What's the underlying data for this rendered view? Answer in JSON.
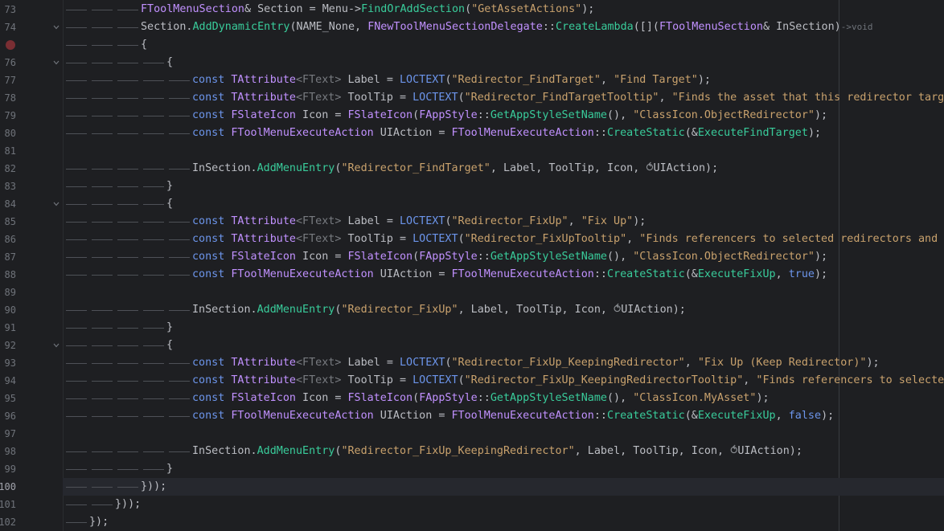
{
  "editor": {
    "lines": [
      {
        "num": "73",
        "indent": 3,
        "tokens": [
          [
            "ty",
            "FToolMenuSection"
          ],
          [
            "pl",
            "& Section = Menu->"
          ],
          [
            "fn",
            "FindOrAddSection"
          ],
          [
            "pl",
            "("
          ],
          [
            "st",
            "\"GetAssetActions\""
          ],
          [
            "pl",
            ");"
          ]
        ]
      },
      {
        "num": "74",
        "indent": 3,
        "fold": true,
        "tokens": [
          [
            "pl",
            "Section."
          ],
          [
            "fn",
            "AddDynamicEntry"
          ],
          [
            "pl",
            "(NAME_None, "
          ],
          [
            "ty",
            "FNewToolMenuSectionDelegate"
          ],
          [
            "pl",
            "::"
          ],
          [
            "fn",
            "CreateLambda"
          ],
          [
            "pl",
            "([]("
          ],
          [
            "ty",
            "FToolMenuSection"
          ],
          [
            "pl",
            "& InSection)"
          ],
          [
            "hint",
            "->void"
          ]
        ]
      },
      {
        "num": "75",
        "indent": 3,
        "breakpoint": true,
        "tokens": [
          [
            "pl",
            "{"
          ]
        ]
      },
      {
        "num": "76",
        "indent": 4,
        "fold": true,
        "tokens": [
          [
            "pl",
            "{"
          ]
        ]
      },
      {
        "num": "77",
        "indent": 5,
        "tokens": [
          [
            "kw",
            "const "
          ],
          [
            "ty",
            "TAttribute"
          ],
          [
            "gr",
            "<FText>"
          ],
          [
            "pl",
            " Label = "
          ],
          [
            "mac",
            "LOCTEXT"
          ],
          [
            "pl",
            "("
          ],
          [
            "st",
            "\"Redirector_FindTarget\""
          ],
          [
            "pl",
            ", "
          ],
          [
            "st",
            "\"Find Target\""
          ],
          [
            "pl",
            ");"
          ]
        ]
      },
      {
        "num": "78",
        "indent": 5,
        "tokens": [
          [
            "kw",
            "const "
          ],
          [
            "ty",
            "TAttribute"
          ],
          [
            "gr",
            "<FText>"
          ],
          [
            "pl",
            " ToolTip = "
          ],
          [
            "mac",
            "LOCTEXT"
          ],
          [
            "pl",
            "("
          ],
          [
            "st",
            "\"Redirector_FindTargetTooltip\""
          ],
          [
            "pl",
            ", "
          ],
          [
            "st",
            "\"Finds the asset that this redirector targe"
          ]
        ]
      },
      {
        "num": "79",
        "indent": 5,
        "tokens": [
          [
            "kw",
            "const "
          ],
          [
            "ty",
            "FSlateIcon"
          ],
          [
            "pl",
            " Icon = "
          ],
          [
            "ty",
            "FSlateIcon"
          ],
          [
            "pl",
            "("
          ],
          [
            "ty",
            "FAppStyle"
          ],
          [
            "pl",
            "::"
          ],
          [
            "fn",
            "GetAppStyleSetName"
          ],
          [
            "pl",
            "(), "
          ],
          [
            "st",
            "\"ClassIcon.ObjectRedirector\""
          ],
          [
            "pl",
            ");"
          ]
        ]
      },
      {
        "num": "80",
        "indent": 5,
        "tokens": [
          [
            "kw",
            "const "
          ],
          [
            "ty",
            "FToolMenuExecuteAction"
          ],
          [
            "pl",
            " UIAction = "
          ],
          [
            "ty",
            "FToolMenuExecuteAction"
          ],
          [
            "pl",
            "::"
          ],
          [
            "fn",
            "CreateStatic"
          ],
          [
            "pl",
            "(&"
          ],
          [
            "fn",
            "ExecuteFindTarget"
          ],
          [
            "pl",
            ");"
          ]
        ]
      },
      {
        "num": "81",
        "indent": 0,
        "tokens": []
      },
      {
        "num": "82",
        "indent": 5,
        "tokens": [
          [
            "pl",
            "InSection."
          ],
          [
            "fn",
            "AddMenuEntry"
          ],
          [
            "pl",
            "("
          ],
          [
            "st",
            "\"Redirector_FindTarget\""
          ],
          [
            "pl",
            ", Label, ToolTip, Icon, "
          ],
          [
            "cap",
            "⥀"
          ],
          [
            "pl",
            "UIAction);"
          ]
        ]
      },
      {
        "num": "83",
        "indent": 4,
        "tokens": [
          [
            "pl",
            "}"
          ]
        ]
      },
      {
        "num": "84",
        "indent": 4,
        "fold": true,
        "tokens": [
          [
            "pl",
            "{"
          ]
        ]
      },
      {
        "num": "85",
        "indent": 5,
        "tokens": [
          [
            "kw",
            "const "
          ],
          [
            "ty",
            "TAttribute"
          ],
          [
            "gr",
            "<FText>"
          ],
          [
            "pl",
            " Label = "
          ],
          [
            "mac",
            "LOCTEXT"
          ],
          [
            "pl",
            "("
          ],
          [
            "st",
            "\"Redirector_FixUp\""
          ],
          [
            "pl",
            ", "
          ],
          [
            "st",
            "\"Fix Up\""
          ],
          [
            "pl",
            ");"
          ]
        ]
      },
      {
        "num": "86",
        "indent": 5,
        "tokens": [
          [
            "kw",
            "const "
          ],
          [
            "ty",
            "TAttribute"
          ],
          [
            "gr",
            "<FText>"
          ],
          [
            "pl",
            " ToolTip = "
          ],
          [
            "mac",
            "LOCTEXT"
          ],
          [
            "pl",
            "("
          ],
          [
            "st",
            "\"Redirector_FixUpTooltip\""
          ],
          [
            "pl",
            ", "
          ],
          [
            "st",
            "\"Finds referencers to selected redirectors and r"
          ]
        ]
      },
      {
        "num": "87",
        "indent": 5,
        "tokens": [
          [
            "kw",
            "const "
          ],
          [
            "ty",
            "FSlateIcon"
          ],
          [
            "pl",
            " Icon = "
          ],
          [
            "ty",
            "FSlateIcon"
          ],
          [
            "pl",
            "("
          ],
          [
            "ty",
            "FAppStyle"
          ],
          [
            "pl",
            "::"
          ],
          [
            "fn",
            "GetAppStyleSetName"
          ],
          [
            "pl",
            "(), "
          ],
          [
            "st",
            "\"ClassIcon.ObjectRedirector\""
          ],
          [
            "pl",
            ");"
          ]
        ]
      },
      {
        "num": "88",
        "indent": 5,
        "tokens": [
          [
            "kw",
            "const "
          ],
          [
            "ty",
            "FToolMenuExecuteAction"
          ],
          [
            "pl",
            " UIAction = "
          ],
          [
            "ty",
            "FToolMenuExecuteAction"
          ],
          [
            "pl",
            "::"
          ],
          [
            "fn",
            "CreateStatic"
          ],
          [
            "pl",
            "(&"
          ],
          [
            "fn",
            "ExecuteFixUp"
          ],
          [
            "pl",
            ", "
          ],
          [
            "kw",
            "true"
          ],
          [
            "pl",
            ");"
          ]
        ]
      },
      {
        "num": "89",
        "indent": 0,
        "tokens": []
      },
      {
        "num": "90",
        "indent": 5,
        "tokens": [
          [
            "pl",
            "InSection."
          ],
          [
            "fn",
            "AddMenuEntry"
          ],
          [
            "pl",
            "("
          ],
          [
            "st",
            "\"Redirector_FixUp\""
          ],
          [
            "pl",
            ", Label, ToolTip, Icon, "
          ],
          [
            "cap",
            "⥀"
          ],
          [
            "pl",
            "UIAction);"
          ]
        ]
      },
      {
        "num": "91",
        "indent": 4,
        "tokens": [
          [
            "pl",
            "}"
          ]
        ]
      },
      {
        "num": "92",
        "indent": 4,
        "fold": true,
        "tokens": [
          [
            "pl",
            "{"
          ]
        ]
      },
      {
        "num": "93",
        "indent": 5,
        "tokens": [
          [
            "kw",
            "const "
          ],
          [
            "ty",
            "TAttribute"
          ],
          [
            "gr",
            "<FText>"
          ],
          [
            "pl",
            " Label = "
          ],
          [
            "mac",
            "LOCTEXT"
          ],
          [
            "pl",
            "("
          ],
          [
            "st",
            "\"Redirector_FixUp_KeepingRedirector\""
          ],
          [
            "pl",
            ", "
          ],
          [
            "st",
            "\"Fix Up (Keep Redirector)\""
          ],
          [
            "pl",
            ");"
          ]
        ]
      },
      {
        "num": "94",
        "indent": 5,
        "tokens": [
          [
            "kw",
            "const "
          ],
          [
            "ty",
            "TAttribute"
          ],
          [
            "gr",
            "<FText>"
          ],
          [
            "pl",
            " ToolTip = "
          ],
          [
            "mac",
            "LOCTEXT"
          ],
          [
            "pl",
            "("
          ],
          [
            "st",
            "\"Redirector_FixUp_KeepingRedirectorTooltip\""
          ],
          [
            "pl",
            ", "
          ],
          [
            "st",
            "\"Finds referencers to selected"
          ]
        ]
      },
      {
        "num": "95",
        "indent": 5,
        "tokens": [
          [
            "kw",
            "const "
          ],
          [
            "ty",
            "FSlateIcon"
          ],
          [
            "pl",
            " Icon = "
          ],
          [
            "ty",
            "FSlateIcon"
          ],
          [
            "pl",
            "("
          ],
          [
            "ty",
            "FAppStyle"
          ],
          [
            "pl",
            "::"
          ],
          [
            "fn",
            "GetAppStyleSetName"
          ],
          [
            "pl",
            "(), "
          ],
          [
            "st",
            "\"ClassIcon.MyAsset\""
          ],
          [
            "pl",
            ");"
          ]
        ]
      },
      {
        "num": "96",
        "indent": 5,
        "tokens": [
          [
            "kw",
            "const "
          ],
          [
            "ty",
            "FToolMenuExecuteAction"
          ],
          [
            "pl",
            " UIAction = "
          ],
          [
            "ty",
            "FToolMenuExecuteAction"
          ],
          [
            "pl",
            "::"
          ],
          [
            "fn",
            "CreateStatic"
          ],
          [
            "pl",
            "(&"
          ],
          [
            "fn",
            "ExecuteFixUp"
          ],
          [
            "pl",
            ", "
          ],
          [
            "kw",
            "false"
          ],
          [
            "pl",
            ");"
          ]
        ]
      },
      {
        "num": "97",
        "indent": 0,
        "tokens": []
      },
      {
        "num": "98",
        "indent": 5,
        "tokens": [
          [
            "pl",
            "InSection."
          ],
          [
            "fn",
            "AddMenuEntry"
          ],
          [
            "pl",
            "("
          ],
          [
            "st",
            "\"Redirector_FixUp_KeepingRedirector\""
          ],
          [
            "pl",
            ", Label, ToolTip, Icon, "
          ],
          [
            "cap",
            "⥀"
          ],
          [
            "pl",
            "UIAction);"
          ]
        ]
      },
      {
        "num": "99",
        "indent": 4,
        "tokens": [
          [
            "pl",
            "}"
          ]
        ]
      },
      {
        "num": "100",
        "indent": 3,
        "current": true,
        "tokens": [
          [
            "pl",
            "}));"
          ]
        ]
      },
      {
        "num": "101",
        "indent": 2,
        "tokens": [
          [
            "pl",
            "}));"
          ]
        ]
      },
      {
        "num": "102",
        "indent": 1,
        "tokens": [
          [
            "pl",
            "});"
          ]
        ]
      }
    ]
  },
  "colors": {
    "background": "#1e1f22",
    "keyword": "#6c95eb",
    "type": "#c191ff",
    "function": "#39cc9b",
    "string": "#c9a26d",
    "text": "#bcbec4",
    "line_number": "#6f737a",
    "breakpoint": "#7a2e33"
  }
}
